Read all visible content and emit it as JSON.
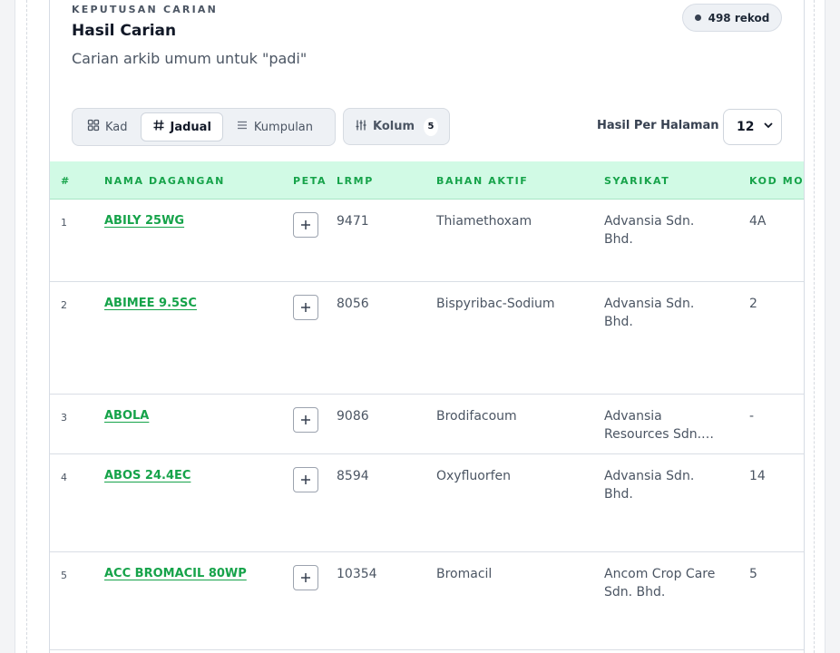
{
  "header": {
    "eyebrow": "KEPUTUSAN CARIAN",
    "title": "Hasil Carian",
    "subtitle": "Carian arkib umum untuk \"padi\"",
    "record_count": "498 rekod"
  },
  "toolbar": {
    "views": [
      {
        "label": "Kad",
        "icon": "grid-icon",
        "active": false
      },
      {
        "label": "Jadual",
        "icon": "hash-icon",
        "active": true
      },
      {
        "label": "Kumpulan",
        "icon": "list-icon",
        "active": false
      }
    ],
    "columns_label": "Kolum",
    "columns_count": "5",
    "per_page_label": "Hasil Per Halaman",
    "per_page_value": "12"
  },
  "table": {
    "headers": [
      "#",
      "NAMA DAGANGAN",
      "PETA",
      "LRMP",
      "BAHAN AKTIF",
      "SYARIKAT",
      "KOD MOA"
    ],
    "rows": [
      {
        "num": "1",
        "name": "ABILY 25WG",
        "lrmp": "9471",
        "bahan": "Thiamethoxam",
        "syarikat": "Advansia Sdn. Bhd.",
        "kod": "4A"
      },
      {
        "num": "2",
        "name": "ABIMEE 9.5SC",
        "lrmp": "8056",
        "bahan": "Bispyribac-Sodium",
        "syarikat": "Advansia Sdn. Bhd.",
        "kod": "2"
      },
      {
        "num": "3",
        "name": "ABOLA",
        "lrmp": "9086",
        "bahan": "Brodifacoum",
        "syarikat": "Advansia Resources Sdn.…",
        "kod": "-"
      },
      {
        "num": "4",
        "name": "ABOS 24.4EC",
        "lrmp": "8594",
        "bahan": "Oxyfluorfen",
        "syarikat": "Advansia Sdn. Bhd.",
        "kod": "14"
      },
      {
        "num": "5",
        "name": "ACC BROMACIL 80WP",
        "lrmp": "10354",
        "bahan": "Bromacil",
        "syarikat": "Ancom Crop Care Sdn. Bhd.",
        "kod": "5"
      }
    ]
  },
  "colors": {
    "accent": "#16a34a",
    "header_bg": "#d1fae5"
  }
}
